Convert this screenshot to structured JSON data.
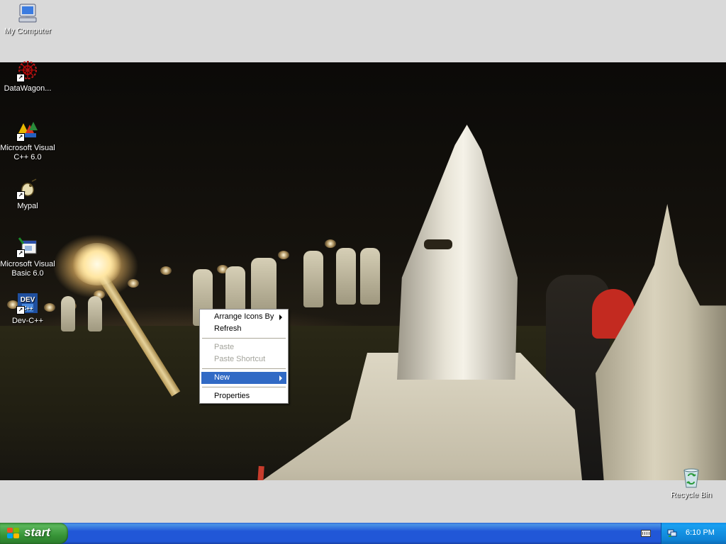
{
  "desktop": {
    "icons": [
      {
        "label": "My Computer",
        "icon": "my-computer-icon"
      },
      {
        "label": "DataWagon...",
        "icon": "datawagon-icon"
      },
      {
        "label": "Microsoft Visual C++ 6.0",
        "icon": "visual-cpp-icon"
      },
      {
        "label": "Mypal",
        "icon": "mypal-icon"
      },
      {
        "label": "Microsoft Visual Basic 6.0",
        "icon": "visual-basic-icon"
      },
      {
        "label": "Dev-C++",
        "icon": "dev-cpp-icon"
      },
      {
        "label": "Recycle Bin",
        "icon": "recycle-bin-icon"
      }
    ]
  },
  "context_menu": {
    "items": [
      {
        "label": "Arrange Icons By",
        "submenu": true,
        "enabled": true
      },
      {
        "label": "Refresh",
        "enabled": true
      },
      {
        "label": "Paste",
        "enabled": false
      },
      {
        "label": "Paste Shortcut",
        "enabled": false
      },
      {
        "label": "New",
        "submenu": true,
        "enabled": true,
        "highlighted": true
      },
      {
        "label": "Properties",
        "enabled": true
      }
    ]
  },
  "taskbar": {
    "start_label": "start",
    "clock": "6:10 PM",
    "tray_icons": [
      "keyboard-icon",
      "network-icon"
    ]
  },
  "colors": {
    "taskbar_blue": "#2157d7",
    "start_green": "#379437",
    "menu_highlight": "#316ac5",
    "desktop_bg": "#d9d9d9"
  }
}
